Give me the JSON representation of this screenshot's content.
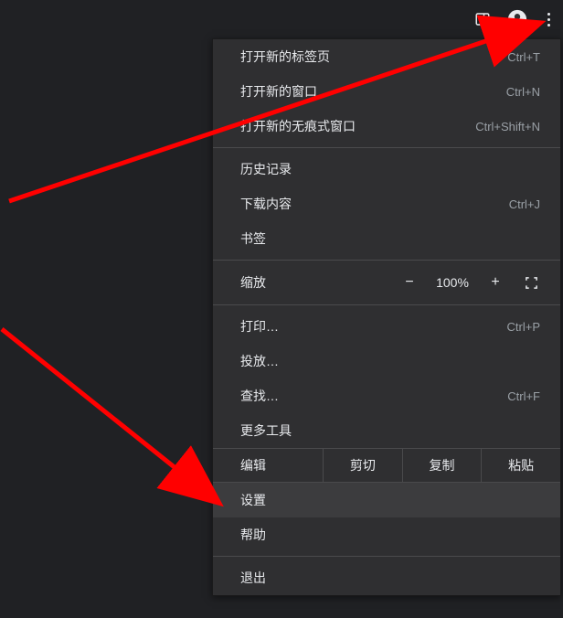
{
  "toolbar": {
    "panel_icon": "side-panel-icon",
    "profile_icon": "profile-icon",
    "kebab_icon": "more-icon"
  },
  "menu": {
    "new_tab": {
      "label": "打开新的标签页",
      "shortcut": "Ctrl+T"
    },
    "new_window": {
      "label": "打开新的窗口",
      "shortcut": "Ctrl+N"
    },
    "new_incognito": {
      "label": "打开新的无痕式窗口",
      "shortcut": "Ctrl+Shift+N"
    },
    "history": {
      "label": "历史记录"
    },
    "downloads": {
      "label": "下载内容",
      "shortcut": "Ctrl+J"
    },
    "bookmarks": {
      "label": "书签"
    },
    "zoom": {
      "label": "缩放",
      "minus": "−",
      "pct": "100%",
      "plus": "+"
    },
    "print": {
      "label": "打印…",
      "shortcut": "Ctrl+P"
    },
    "cast": {
      "label": "投放…"
    },
    "find": {
      "label": "查找…",
      "shortcut": "Ctrl+F"
    },
    "more_tools": {
      "label": "更多工具"
    },
    "edit": {
      "label": "编辑",
      "cut": "剪切",
      "copy": "复制",
      "paste": "粘贴"
    },
    "settings": {
      "label": "设置"
    },
    "help": {
      "label": "帮助"
    },
    "exit": {
      "label": "退出"
    }
  }
}
